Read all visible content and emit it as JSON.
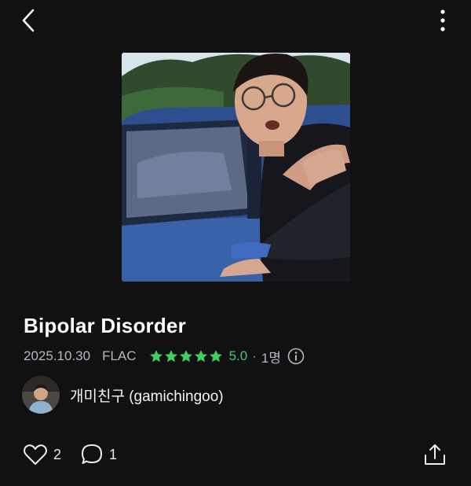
{
  "header": {
    "back_icon": "chevron-left-icon",
    "more_icon": "more-vertical-icon"
  },
  "track": {
    "title": "Bipolar Disorder",
    "date": "2025.10.30",
    "format": "FLAC",
    "rating_value": "5.0",
    "stars_filled": 5,
    "stars_total": 5,
    "separator": "·",
    "raters": "1명",
    "info_icon": "info-circle-icon"
  },
  "artist": {
    "name": "개미친구 (gamichingoo)"
  },
  "actions": {
    "like_count": "2",
    "comment_count": "1",
    "like_icon": "heart-outline-icon",
    "comment_icon": "comment-bubble-icon",
    "share_icon": "share-upload-icon"
  },
  "colors": {
    "background": "#111113",
    "star": "#3ed160",
    "text_primary": "#ffffff",
    "text_secondary": "#b9b9bd"
  }
}
